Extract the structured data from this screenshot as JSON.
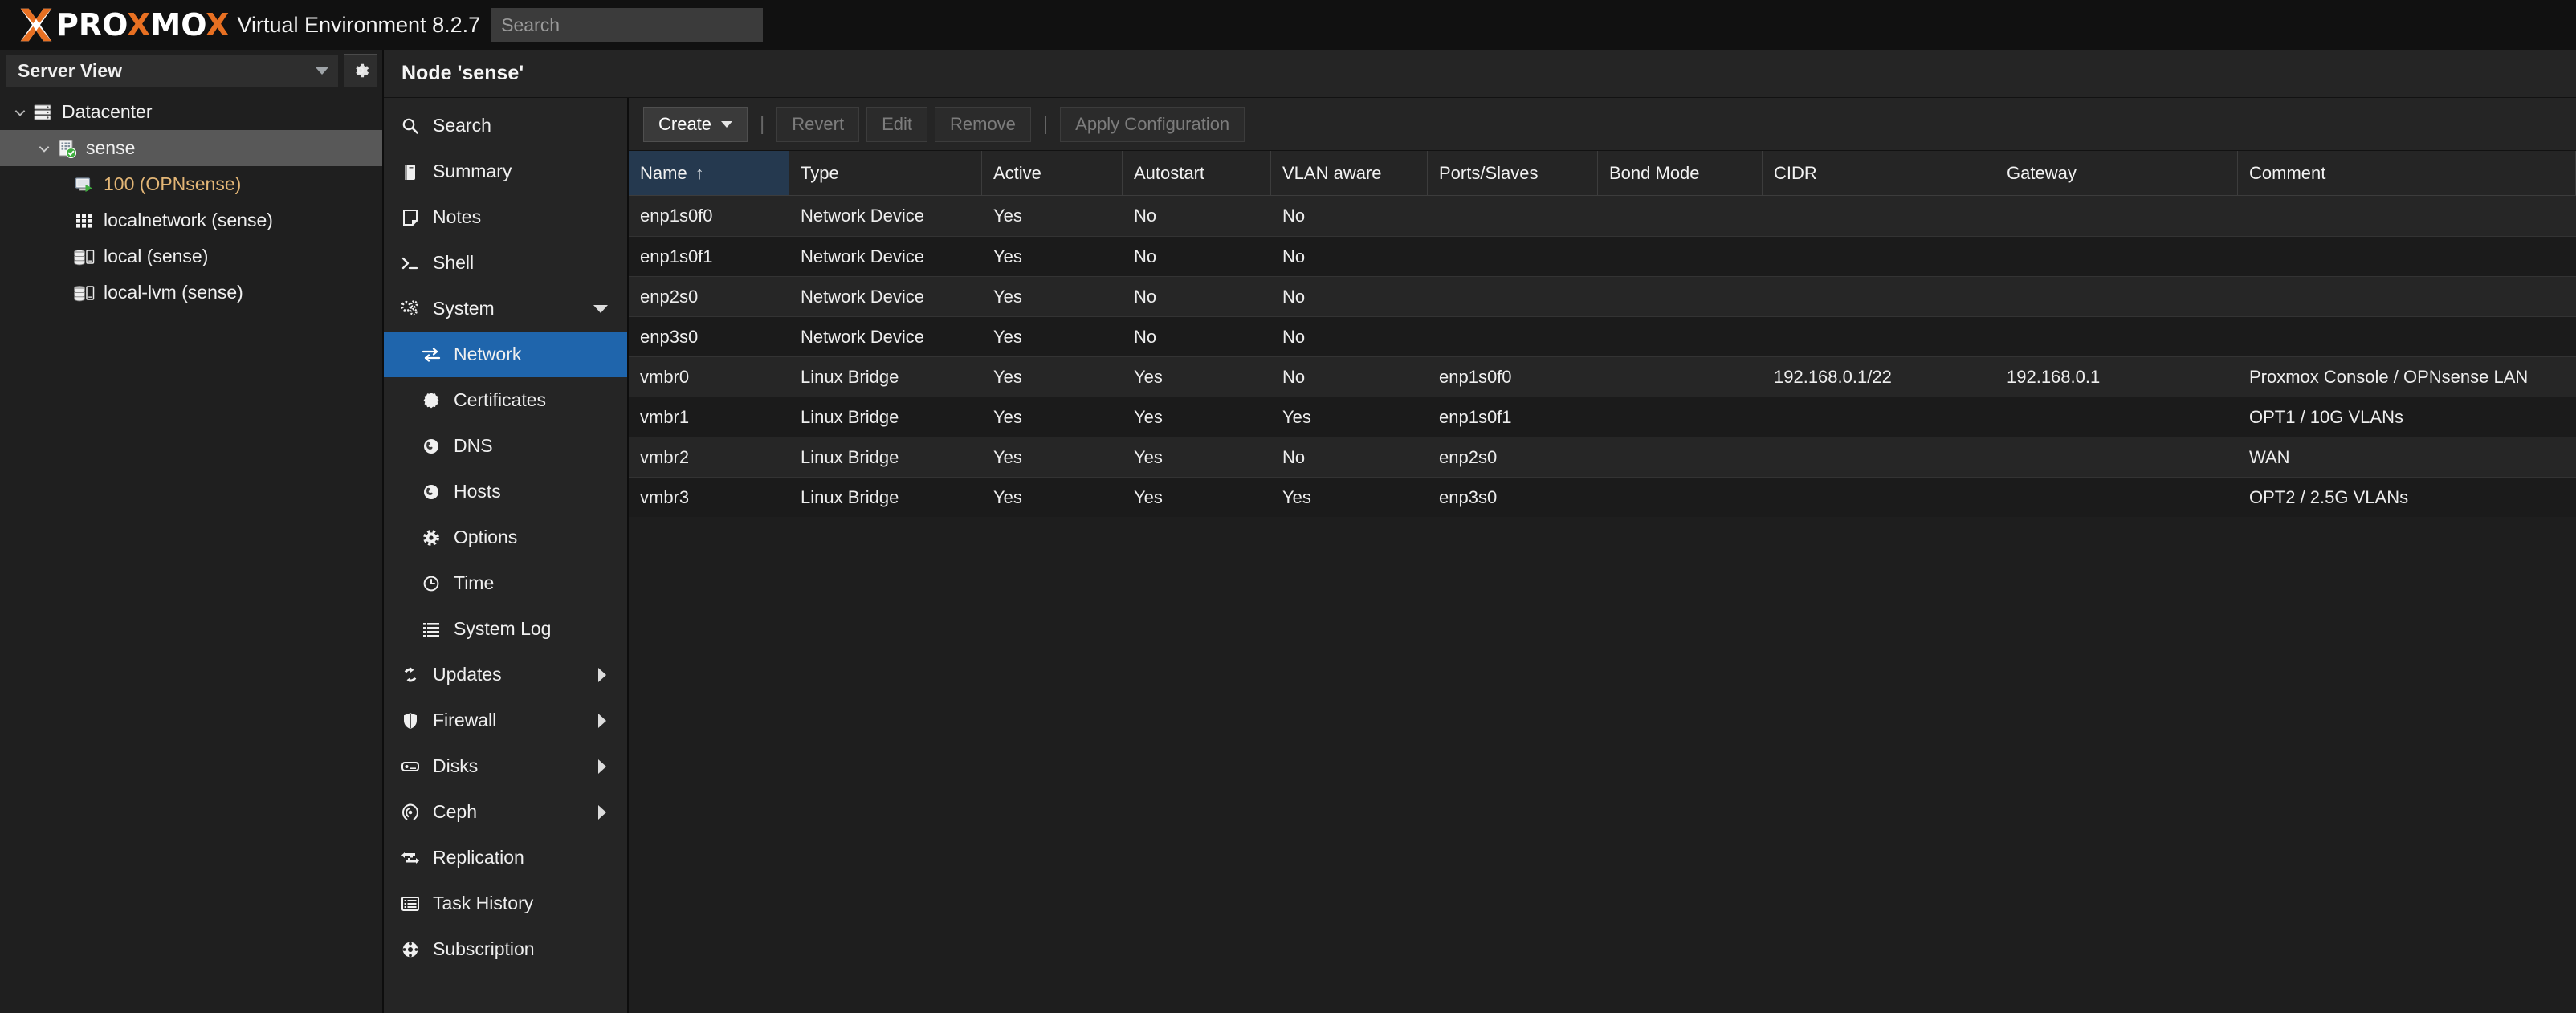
{
  "header": {
    "brand_word_1": "PRO",
    "brand_x": "X",
    "brand_word_2": "MO",
    "brand_x2": "X",
    "product_name": "Virtual Environment 8.2.7",
    "search_placeholder": "Search",
    "search_value": "",
    "accent_color": "#e87022"
  },
  "sidebar": {
    "view_selector_label": "Server View",
    "settings_icon": "gear-icon",
    "tree": [
      {
        "label": "Datacenter",
        "icon": "datacenter-icon",
        "depth": 1,
        "expanded": true,
        "selected": false
      },
      {
        "label": "sense",
        "icon": "node-icon",
        "depth": 2,
        "expanded": true,
        "selected": true
      },
      {
        "label": "100 (OPNsense)",
        "icon": "qemu-vm-icon",
        "depth": 3,
        "expanded": null,
        "selected": false
      },
      {
        "label": "localnetwork (sense)",
        "icon": "sdn-grid-icon",
        "depth": 3,
        "expanded": null,
        "selected": false
      },
      {
        "label": "local (sense)",
        "icon": "storage-icon",
        "depth": 3,
        "expanded": null,
        "selected": false
      },
      {
        "label": "local-lvm (sense)",
        "icon": "storage-icon",
        "depth": 3,
        "expanded": null,
        "selected": false
      }
    ]
  },
  "content": {
    "node_title": "Node 'sense'",
    "nav_items": [
      {
        "label": "Search",
        "icon": "search-icon",
        "sub": false,
        "active": false,
        "caret": null
      },
      {
        "label": "Summary",
        "icon": "book-icon",
        "sub": false,
        "active": false,
        "caret": null
      },
      {
        "label": "Notes",
        "icon": "note-icon",
        "sub": false,
        "active": false,
        "caret": null
      },
      {
        "label": "Shell",
        "icon": "terminal-icon",
        "sub": false,
        "active": false,
        "caret": null
      },
      {
        "label": "System",
        "icon": "gears-icon",
        "sub": false,
        "active": false,
        "caret": "down"
      },
      {
        "label": "Network",
        "icon": "network-swap-icon",
        "sub": true,
        "active": true,
        "caret": null
      },
      {
        "label": "Certificates",
        "icon": "certificate-icon",
        "sub": true,
        "active": false,
        "caret": null
      },
      {
        "label": "DNS",
        "icon": "globe-icon",
        "sub": true,
        "active": false,
        "caret": null
      },
      {
        "label": "Hosts",
        "icon": "globe-icon",
        "sub": true,
        "active": false,
        "caret": null
      },
      {
        "label": "Options",
        "icon": "gear-icon",
        "sub": true,
        "active": false,
        "caret": null
      },
      {
        "label": "Time",
        "icon": "clock-icon",
        "sub": true,
        "active": false,
        "caret": null
      },
      {
        "label": "System Log",
        "icon": "list-icon",
        "sub": true,
        "active": false,
        "caret": null
      },
      {
        "label": "Updates",
        "icon": "refresh-icon",
        "sub": false,
        "active": false,
        "caret": "right"
      },
      {
        "label": "Firewall",
        "icon": "shield-icon",
        "sub": false,
        "active": false,
        "caret": "right"
      },
      {
        "label": "Disks",
        "icon": "disk-icon",
        "sub": false,
        "active": false,
        "caret": "right"
      },
      {
        "label": "Ceph",
        "icon": "ceph-icon",
        "sub": false,
        "active": false,
        "caret": "right"
      },
      {
        "label": "Replication",
        "icon": "replication-icon",
        "sub": false,
        "active": false,
        "caret": null
      },
      {
        "label": "Task History",
        "icon": "task-list-icon",
        "sub": false,
        "active": false,
        "caret": null
      },
      {
        "label": "Subscription",
        "icon": "subscription-icon",
        "sub": false,
        "active": false,
        "caret": null
      }
    ],
    "toolbar": {
      "create_label": "Create",
      "revert_label": "Revert",
      "edit_label": "Edit",
      "remove_label": "Remove",
      "apply_label": "Apply Configuration",
      "separator": "|"
    },
    "table": {
      "sorted_column": "Name",
      "sort_direction": "asc",
      "sort_arrow_glyph": "↑",
      "columns": [
        {
          "key": "name",
          "label": "Name",
          "cls": "c-name"
        },
        {
          "key": "type",
          "label": "Type",
          "cls": "c-type"
        },
        {
          "key": "active",
          "label": "Active",
          "cls": "c-active"
        },
        {
          "key": "autostart",
          "label": "Autostart",
          "cls": "c-autostart"
        },
        {
          "key": "vlan",
          "label": "VLAN aware",
          "cls": "c-vlan"
        },
        {
          "key": "ports",
          "label": "Ports/Slaves",
          "cls": "c-ports"
        },
        {
          "key": "bond",
          "label": "Bond Mode",
          "cls": "c-bond"
        },
        {
          "key": "cidr",
          "label": "CIDR",
          "cls": "c-cidr"
        },
        {
          "key": "gateway",
          "label": "Gateway",
          "cls": "c-gw"
        },
        {
          "key": "comment",
          "label": "Comment",
          "cls": "c-comment"
        }
      ],
      "rows": [
        {
          "name": "enp1s0f0",
          "type": "Network Device",
          "active": "Yes",
          "autostart": "No",
          "vlan": "No",
          "ports": "",
          "bond": "",
          "cidr": "",
          "gateway": "",
          "comment": ""
        },
        {
          "name": "enp1s0f1",
          "type": "Network Device",
          "active": "Yes",
          "autostart": "No",
          "vlan": "No",
          "ports": "",
          "bond": "",
          "cidr": "",
          "gateway": "",
          "comment": ""
        },
        {
          "name": "enp2s0",
          "type": "Network Device",
          "active": "Yes",
          "autostart": "No",
          "vlan": "No",
          "ports": "",
          "bond": "",
          "cidr": "",
          "gateway": "",
          "comment": ""
        },
        {
          "name": "enp3s0",
          "type": "Network Device",
          "active": "Yes",
          "autostart": "No",
          "vlan": "No",
          "ports": "",
          "bond": "",
          "cidr": "",
          "gateway": "",
          "comment": ""
        },
        {
          "name": "vmbr0",
          "type": "Linux Bridge",
          "active": "Yes",
          "autostart": "Yes",
          "vlan": "No",
          "ports": "enp1s0f0",
          "bond": "",
          "cidr": "192.168.0.1/22",
          "gateway": "192.168.0.1",
          "comment": "Proxmox Console / OPNsense LAN"
        },
        {
          "name": "vmbr1",
          "type": "Linux Bridge",
          "active": "Yes",
          "autostart": "Yes",
          "vlan": "Yes",
          "ports": "enp1s0f1",
          "bond": "",
          "cidr": "",
          "gateway": "",
          "comment": "OPT1 / 10G VLANs"
        },
        {
          "name": "vmbr2",
          "type": "Linux Bridge",
          "active": "Yes",
          "autostart": "Yes",
          "vlan": "No",
          "ports": "enp2s0",
          "bond": "",
          "cidr": "",
          "gateway": "",
          "comment": "WAN"
        },
        {
          "name": "vmbr3",
          "type": "Linux Bridge",
          "active": "Yes",
          "autostart": "Yes",
          "vlan": "Yes",
          "ports": "enp3s0",
          "bond": "",
          "cidr": "",
          "gateway": "",
          "comment": "OPT2 / 2.5G VLANs"
        }
      ]
    }
  }
}
